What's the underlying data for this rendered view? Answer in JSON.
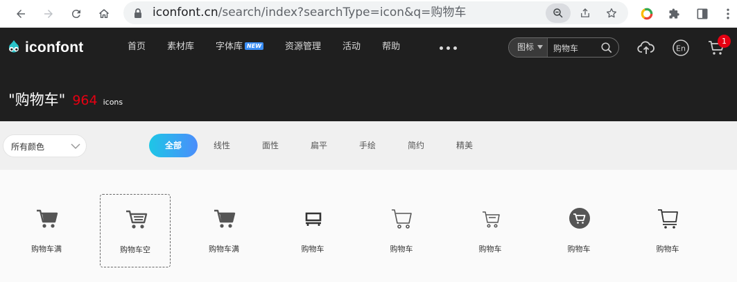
{
  "browser": {
    "url_host": "iconfont.cn",
    "url_rest": "/search/index?searchType=icon&q=购物车"
  },
  "header": {
    "logo_text": "iconfont",
    "nav": [
      {
        "label": "首页"
      },
      {
        "label": "素材库"
      },
      {
        "label": "字体库",
        "badge": "NEW"
      },
      {
        "label": "资源管理"
      },
      {
        "label": "活动"
      },
      {
        "label": "帮助"
      }
    ],
    "search_type": "图标",
    "search_value": "购物车",
    "cart_count": "1",
    "lang_label": "En"
  },
  "results": {
    "query": "\"购物车\"",
    "count": "964",
    "unit": "icons"
  },
  "filters": {
    "color_select": "所有颜色",
    "styles": [
      "全部",
      "线性",
      "面性",
      "扁平",
      "手绘",
      "简约",
      "精美"
    ],
    "active_style": "全部"
  },
  "icons": [
    {
      "name": "购物车满",
      "icon": "cart-full-icon"
    },
    {
      "name": "购物车空",
      "icon": "cart-empty-icon",
      "selected": true
    },
    {
      "name": "购物车满",
      "icon": "cart-full-icon"
    },
    {
      "name": "购物车",
      "icon": "cart-icon"
    },
    {
      "name": "购物车",
      "icon": "cart-outline-icon"
    },
    {
      "name": "购物车",
      "icon": "cart-thin-icon"
    },
    {
      "name": "购物车",
      "icon": "cart-circle-icon"
    },
    {
      "name": "购物车",
      "icon": "cart-line-icon"
    }
  ],
  "colors": {
    "header_bg": "#1f1f1f",
    "accent_red": "#e60012",
    "tab_gradient_start": "#1ec6e6",
    "tab_gradient_end": "#4b8dfb",
    "icon_gray": "#555555"
  }
}
